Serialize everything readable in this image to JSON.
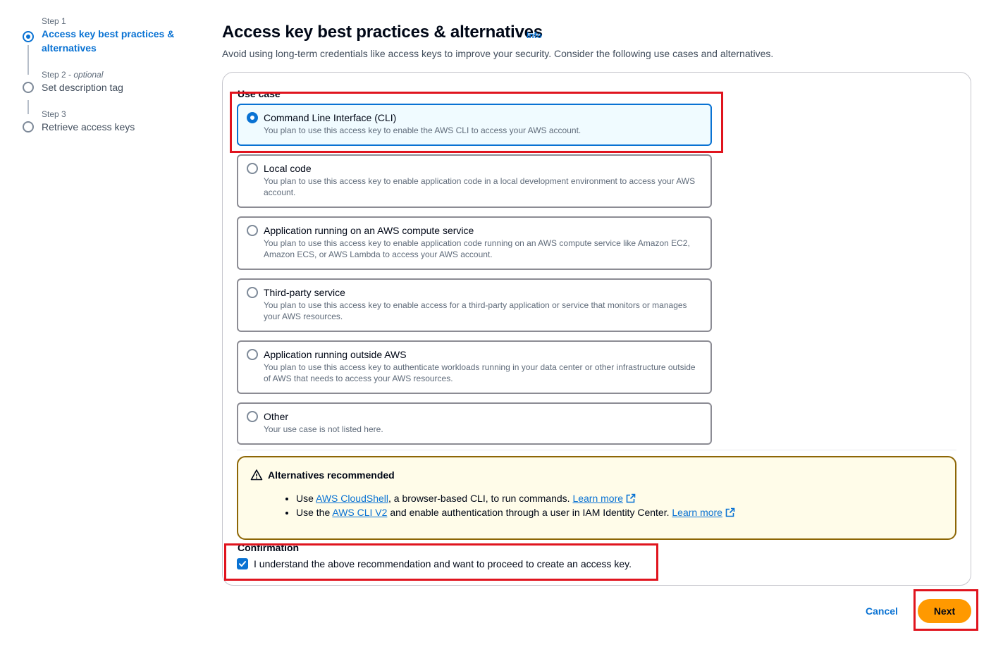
{
  "steps": [
    {
      "meta": "Step 1",
      "meta_suffix": "",
      "title": "Access key best practices & alternatives"
    },
    {
      "meta": "Step 2 - ",
      "meta_suffix": "optional",
      "title": "Set description tag"
    },
    {
      "meta": "Step 3",
      "meta_suffix": "",
      "title": "Retrieve access keys"
    }
  ],
  "header": {
    "title": "Access key best practices & alternatives",
    "info": "Info",
    "description": "Avoid using long-term credentials like access keys to improve your security. Consider the following use cases and alternatives."
  },
  "use_case": {
    "label": "Use case",
    "selected": "Command Line Interface (CLI)",
    "options": [
      {
        "title": "Command Line Interface (CLI)",
        "desc": "You plan to use this access key to enable the AWS CLI to access your AWS account."
      },
      {
        "title": "Local code",
        "desc": "You plan to use this access key to enable application code in a local development environment to access your AWS account."
      },
      {
        "title": "Application running on an AWS compute service",
        "desc": "You plan to use this access key to enable application code running on an AWS compute service like Amazon EC2, Amazon ECS, or AWS Lambda to access your AWS account."
      },
      {
        "title": "Third-party service",
        "desc": "You plan to use this access key to enable access for a third-party application or service that monitors or manages your AWS resources."
      },
      {
        "title": "Application running outside AWS",
        "desc": "You plan to use this access key to authenticate workloads running in your data center or other infrastructure outside of AWS that needs to access your AWS resources."
      },
      {
        "title": "Other",
        "desc": "Your use case is not listed here."
      }
    ]
  },
  "alert": {
    "icon": "warning-icon",
    "title": "Alternatives recommended",
    "item1": {
      "prefix": "Use ",
      "link": "AWS CloudShell",
      "text": ", a browser-based CLI, to run commands. ",
      "learn": "Learn more"
    },
    "item2": {
      "prefix": "Use the ",
      "link": "AWS CLI V2",
      "text": " and enable authentication through a user in IAM Identity Center. ",
      "learn": "Learn more"
    }
  },
  "confirmation": {
    "label": "Confirmation",
    "checked": true,
    "text": "I understand the above recommendation and want to proceed to create an access key."
  },
  "footer": {
    "cancel": "Cancel",
    "next": "Next"
  },
  "colors": {
    "primary": "#0972d3",
    "next_button": "#ff9900",
    "warning_border": "#8d6605",
    "warning_bg": "#fffce9",
    "annotation_red": "#e0141e"
  }
}
